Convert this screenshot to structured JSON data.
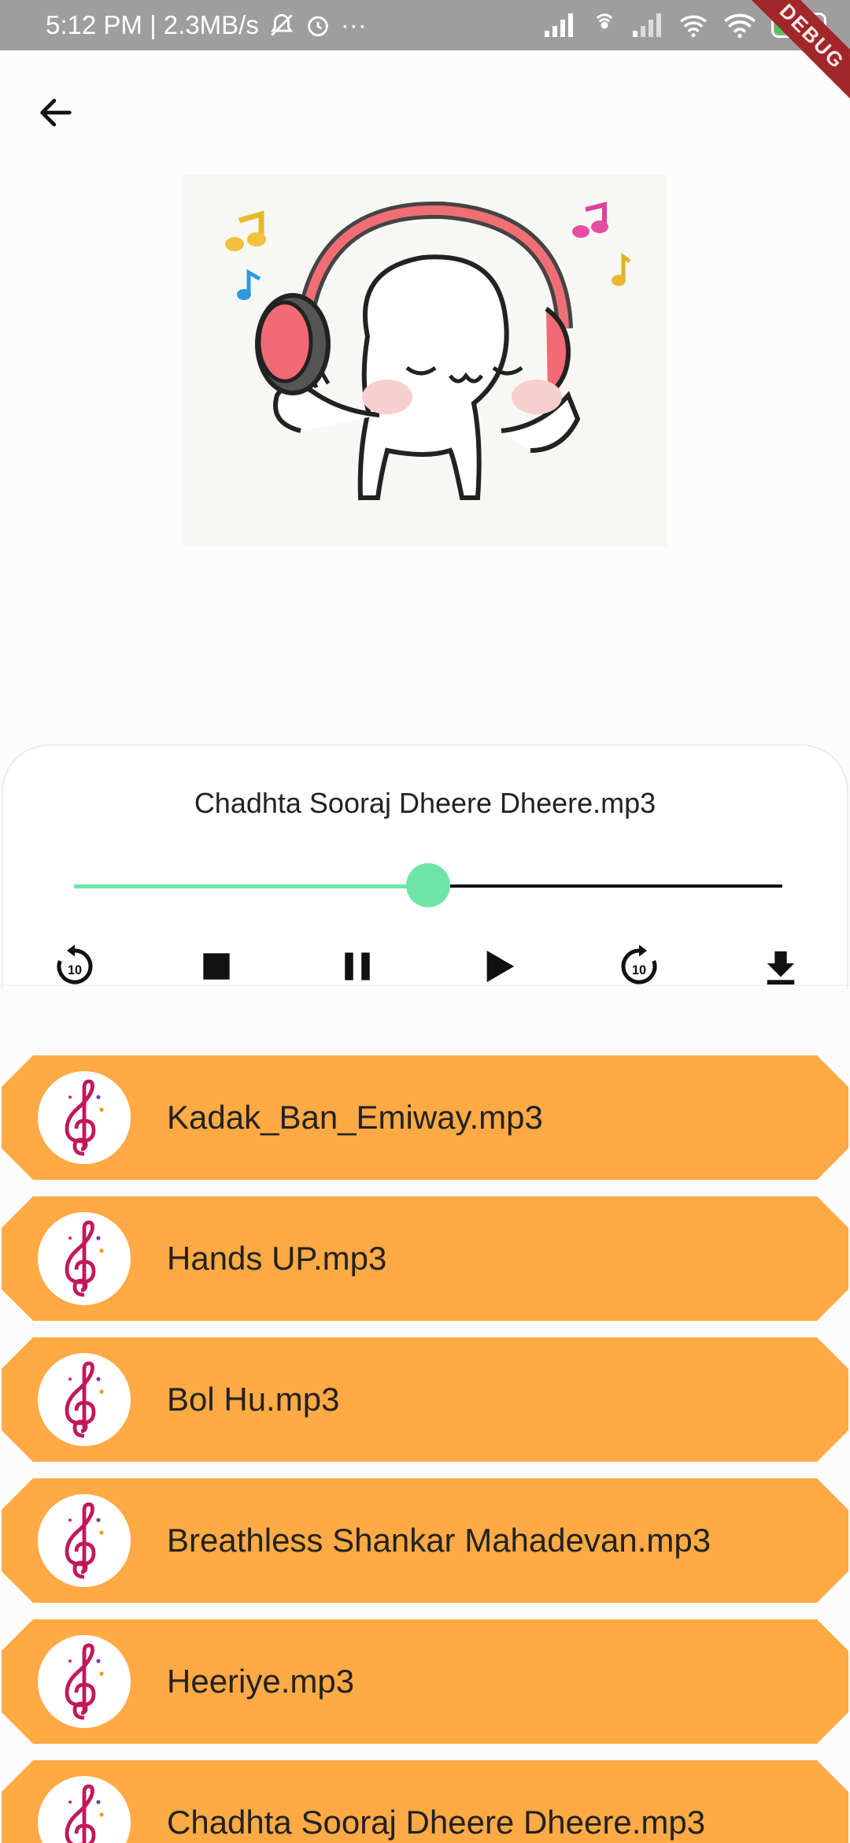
{
  "status_bar": {
    "left_text": "5:12 PM | 2.3MB/s",
    "more": "···",
    "battery_level": "78",
    "debug_label": "DEBUG",
    "icons": [
      "mute-icon",
      "alarm-icon",
      "signal-icon",
      "hotspot-icon",
      "signal2-icon",
      "wifi-icon",
      "wifi2-icon",
      "battery-icon"
    ]
  },
  "header": {
    "back_icon": "arrow-left-icon"
  },
  "artwork": {
    "description_icon": "headphones-bear-illustration"
  },
  "player": {
    "now_playing": "Chadhta Sooraj Dheere Dheere.mp3",
    "progress": 0.5,
    "accent_color": "#6ee5a6",
    "controls": [
      {
        "name": "rewind-10-button",
        "icon": "replay-10-icon",
        "label": "10"
      },
      {
        "name": "stop-button",
        "icon": "stop-icon"
      },
      {
        "name": "pause-button",
        "icon": "pause-icon"
      },
      {
        "name": "play-button",
        "icon": "play-icon"
      },
      {
        "name": "forward-10-button",
        "icon": "forward-10-icon",
        "label": "10"
      },
      {
        "name": "download-button",
        "icon": "download-icon"
      }
    ]
  },
  "songs": [
    {
      "title": "Kadak_Ban_Emiway.mp3"
    },
    {
      "title": "Hands UP.mp3"
    },
    {
      "title": "Bol Hu.mp3"
    },
    {
      "title": "Breathless Shankar Mahadevan.mp3"
    },
    {
      "title": "Heeriye.mp3"
    },
    {
      "title": "Chadhta Sooraj Dheere Dheere.mp3"
    }
  ],
  "colors": {
    "list_item": "#ffaa45",
    "status_bar": "#9e9e9e",
    "debug_ribbon": "#a3262a"
  }
}
